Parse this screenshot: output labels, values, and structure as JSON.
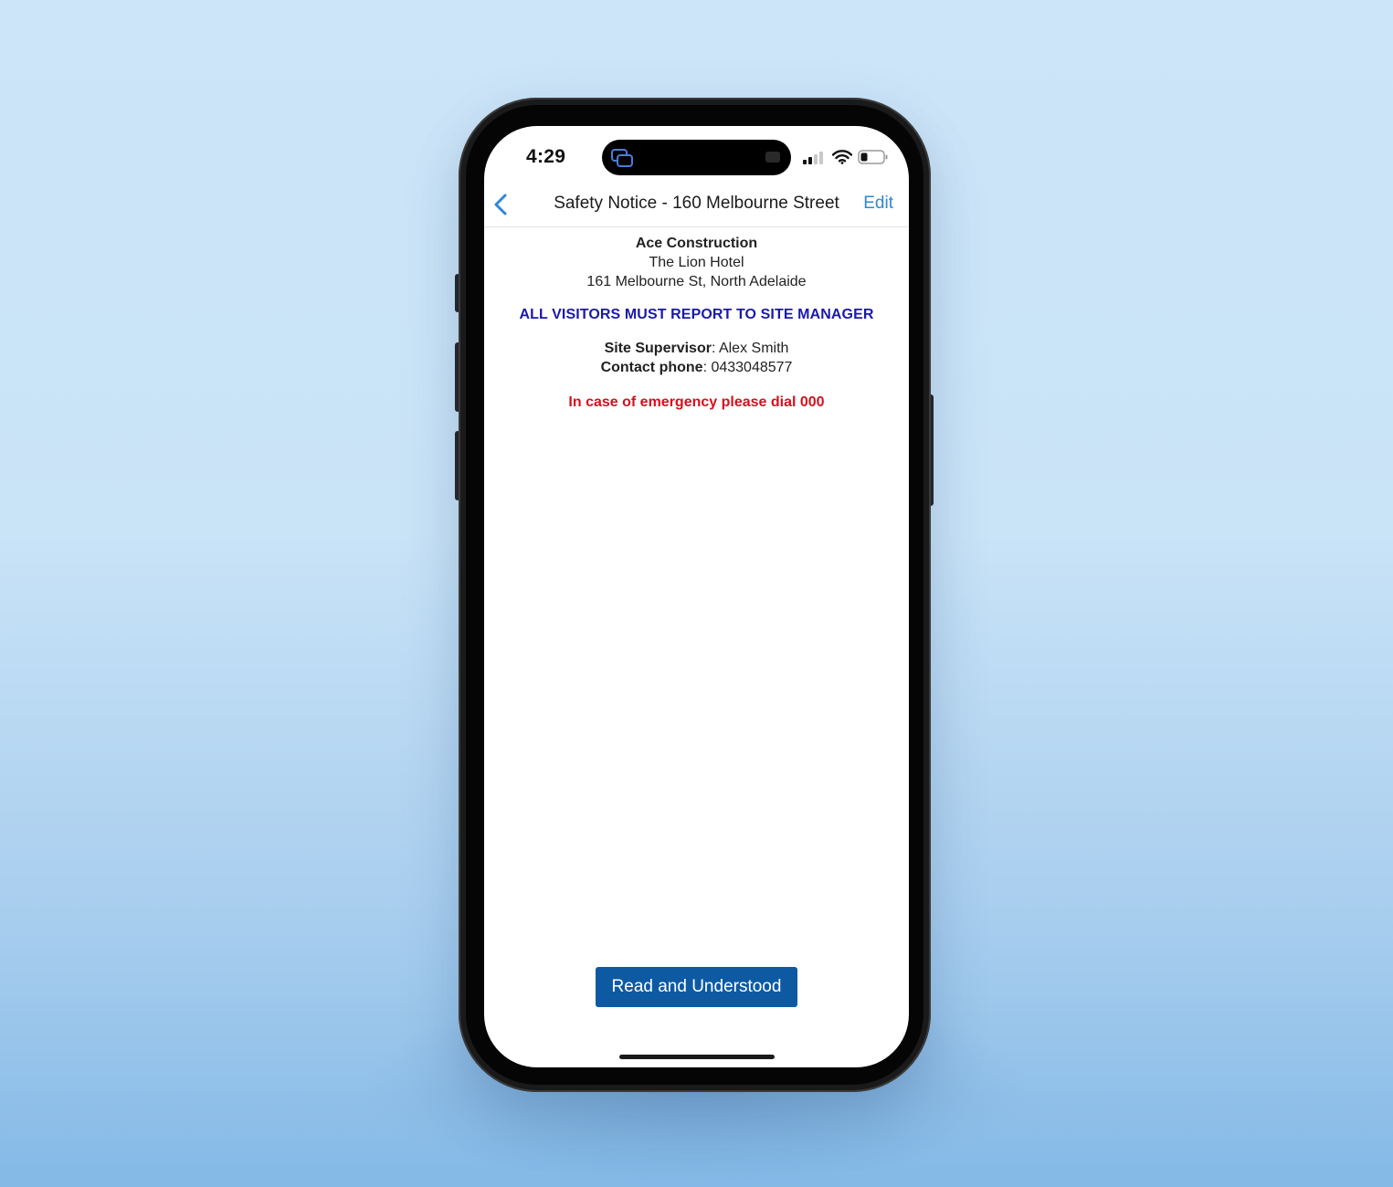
{
  "status_bar": {
    "time": "4:29"
  },
  "navbar": {
    "title": "Safety Notice - 160 Melbourne Street",
    "edit_label": "Edit"
  },
  "notice": {
    "company": "Ace Construction",
    "site_name": "The Lion Hotel",
    "address": "161 Melbourne St, North Adelaide",
    "headline": "ALL VISITORS MUST REPORT TO SITE MANAGER",
    "supervisor_label": "Site Supervisor",
    "supervisor_value": ": Alex Smith",
    "phone_label": "Contact phone",
    "phone_value": ": 0433048577",
    "emergency": "In case of emergency please dial 000"
  },
  "actions": {
    "acknowledge_label": "Read and Understood"
  },
  "colors": {
    "accent": "#2f86d6",
    "headline": "#1a1aa8",
    "emergency": "#d6101e",
    "button": "#0d5aa3"
  }
}
